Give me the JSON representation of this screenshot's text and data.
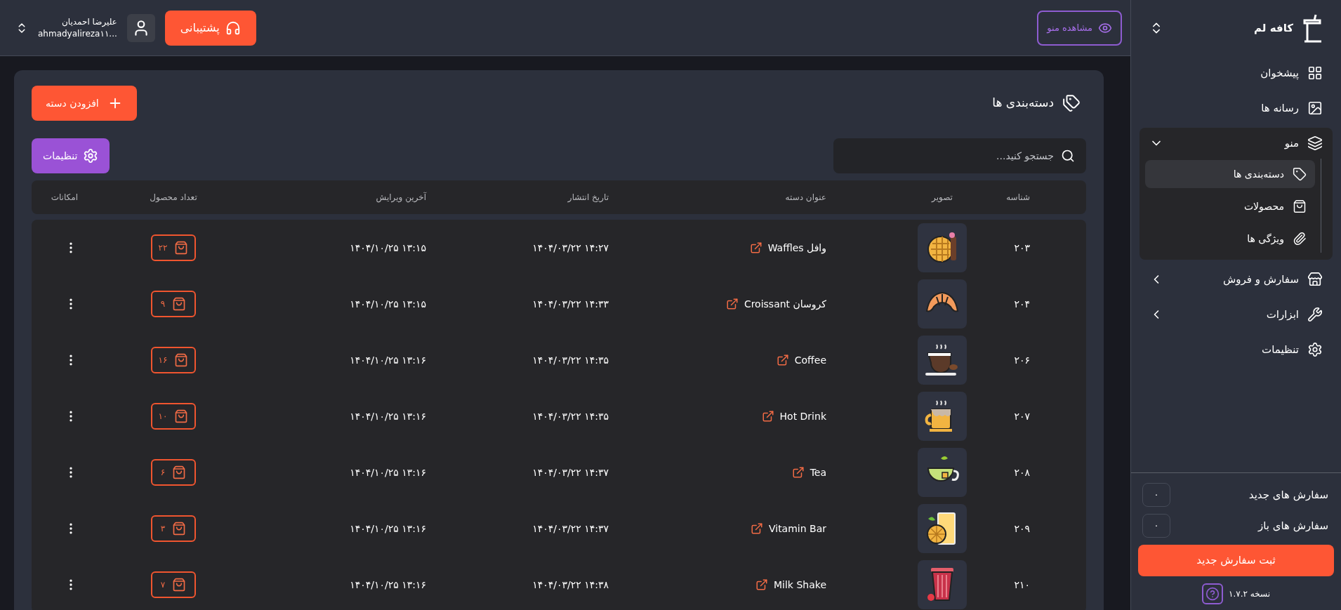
{
  "top_bar": {
    "view_menu_button": "مشاهده منو",
    "support_button": "پشتیبانی",
    "user": {
      "name": "علیرضا احمدیان",
      "username": "ahmadyalireza۱۱..."
    }
  },
  "page": {
    "title": "دسته‌بندی ها",
    "add_button": "افزودن دسته",
    "search": {
      "placeholder": "جستجو کنید..."
    },
    "settings_button": "تنظیمات"
  },
  "table": {
    "columns": [
      "شناسه",
      "تصویر",
      "عنوان دسته",
      "تاریخ انتشار",
      "آخرین ویرایش",
      "تعداد محصول",
      "امکانات"
    ],
    "rows": [
      {
        "id": "۲۰۳",
        "title": "وافل Waffles",
        "published": "۱۴۰۴/۰۳/۲۲ ۱۴:۲۷",
        "edited": "۱۴۰۴/۱۰/۲۵ ۱۳:۱۵",
        "product_count": "۲۲"
      },
      {
        "id": "۲۰۴",
        "title": "کروسان Croissant",
        "published": "۱۴۰۴/۰۳/۲۲ ۱۴:۳۳",
        "edited": "۱۴۰۴/۱۰/۲۵ ۱۳:۱۵",
        "product_count": "۹"
      },
      {
        "id": "۲۰۶",
        "title": "Coffee",
        "published": "۱۴۰۴/۰۳/۲۲ ۱۴:۳۵",
        "edited": "۱۴۰۴/۱۰/۲۵ ۱۳:۱۶",
        "product_count": "۱۶"
      },
      {
        "id": "۲۰۷",
        "title": "Hot Drink",
        "published": "۱۴۰۴/۰۳/۲۲ ۱۴:۳۵",
        "edited": "۱۴۰۴/۱۰/۲۵ ۱۳:۱۶",
        "product_count": "۱۰"
      },
      {
        "id": "۲۰۸",
        "title": "Tea",
        "published": "۱۴۰۴/۰۳/۲۲ ۱۴:۳۷",
        "edited": "۱۴۰۴/۱۰/۲۵ ۱۳:۱۶",
        "product_count": "۶"
      },
      {
        "id": "۲۰۹",
        "title": "Vitamin Bar",
        "published": "۱۴۰۴/۰۳/۲۲ ۱۴:۳۷",
        "edited": "۱۴۰۴/۱۰/۲۵ ۱۳:۱۶",
        "product_count": "۳"
      },
      {
        "id": "۲۱۰",
        "title": "Milk Shake",
        "published": "۱۴۰۴/۰۳/۲۲ ۱۴:۳۸",
        "edited": "۱۴۰۴/۱۰/۲۵ ۱۳:۱۶",
        "product_count": "۷"
      }
    ]
  },
  "sidebar": {
    "brand": "کافه لم",
    "items": [
      {
        "label": "پیشخوان",
        "selected": false
      },
      {
        "label": "رسانه ها",
        "selected": false
      },
      {
        "label": "منو",
        "selected": false,
        "expanded": true,
        "children": [
          {
            "label": "دسته‌بندی ها",
            "selected": true
          },
          {
            "label": "محصولات",
            "selected": false
          },
          {
            "label": "ویژگی ها",
            "selected": false
          }
        ]
      },
      {
        "label": "سفارش و فروش",
        "selected": false,
        "expanded": false
      },
      {
        "label": "ابزارات",
        "selected": false,
        "expanded": false
      },
      {
        "label": "تنظیمات",
        "selected": false
      }
    ],
    "counters": [
      {
        "label": "سفارش های جدید",
        "value": "۰"
      },
      {
        "label": "سفارش های باز",
        "value": "۰"
      }
    ],
    "new_order_button": "ثبت سفارش جدید",
    "version": "نسخه ۱.۷.۲"
  }
}
